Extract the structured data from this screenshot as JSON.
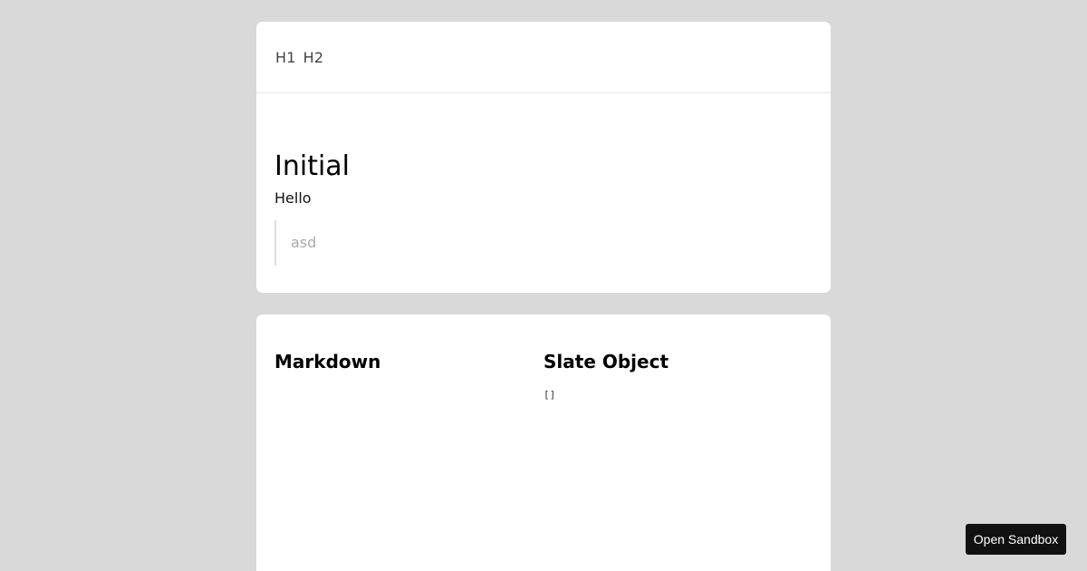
{
  "toolbar": {
    "buttons": [
      {
        "label": "H1"
      },
      {
        "label": "H2"
      }
    ]
  },
  "editor": {
    "heading": "Initial",
    "paragraph": "Hello",
    "blockquote": "asd"
  },
  "output": {
    "markdown_title": "Markdown",
    "markdown_value": "",
    "slate_title": "Slate Object",
    "slate_value": "[]"
  },
  "sandbox_button": {
    "label": "Open Sandbox"
  },
  "colors": {
    "background": "#d9d9d9",
    "card": "#ffffff",
    "button_bg": "#111111",
    "button_text": "#ffffff"
  }
}
